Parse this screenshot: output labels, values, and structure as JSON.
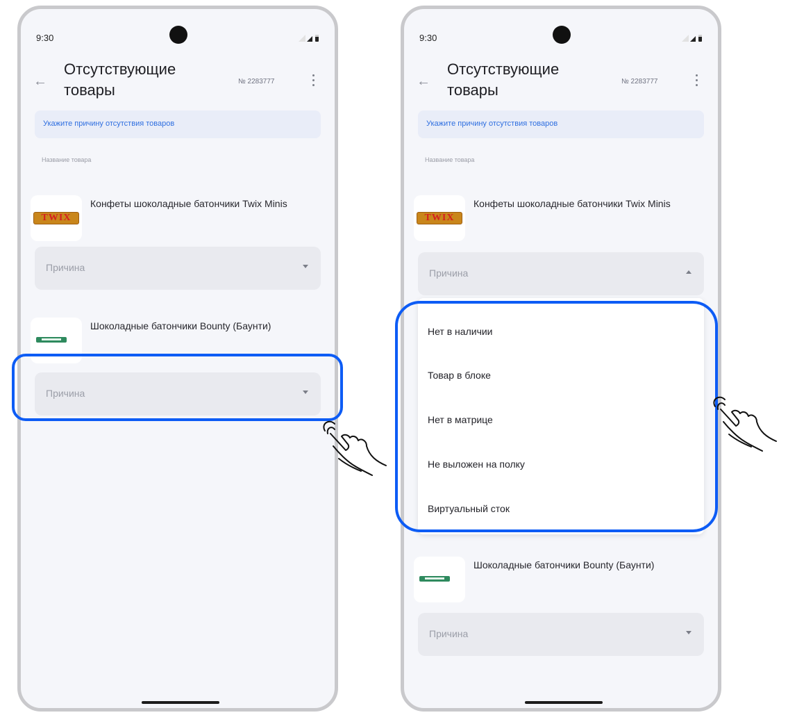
{
  "phones": [
    {
      "status": {
        "time": "9:30"
      },
      "header": {
        "title": "Отсутствующие товары",
        "order_number": "№ 2283777"
      },
      "hint": "Укажите причину отсутствия товаров",
      "column_label": "Название товара",
      "products": [
        {
          "name": "Конфеты шоколадные батончики Twix Minis",
          "reason_placeholder": "Причина",
          "dropdown_open": false
        },
        {
          "name": "Шоколадные батончики Bounty (Баунти)",
          "reason_placeholder": "Причина",
          "dropdown_open": false
        }
      ]
    },
    {
      "status": {
        "time": "9:30"
      },
      "header": {
        "title": "Отсутствующие товары",
        "order_number": "№ 2283777"
      },
      "hint": "Укажите причину отсутствия товаров",
      "column_label": "Название товара",
      "products": [
        {
          "name": "Конфеты шоколадные батончики Twix Minis",
          "reason_placeholder": "Причина",
          "dropdown_open": true
        },
        {
          "name": "Шоколадные батончики Bounty (Баунти)",
          "reason_placeholder": "Причина",
          "dropdown_open": false
        }
      ],
      "reason_options": [
        "Нет в наличии",
        "Товар в блоке",
        "Нет в матрице",
        "Не выложен на полку",
        "Виртуальный сток"
      ]
    }
  ],
  "product_logos": {
    "twix": "TWIX"
  },
  "icons": {
    "back": "arrow-left-icon",
    "more": "more-vertical-icon",
    "dropdown": "chevron-down-icon",
    "tap": "tap-hand-icon"
  },
  "colors": {
    "highlight": "#0d5cf5",
    "hint_text": "#2f6fe0",
    "hint_bg": "#e9edf8",
    "field_bg": "#e9eaef"
  }
}
